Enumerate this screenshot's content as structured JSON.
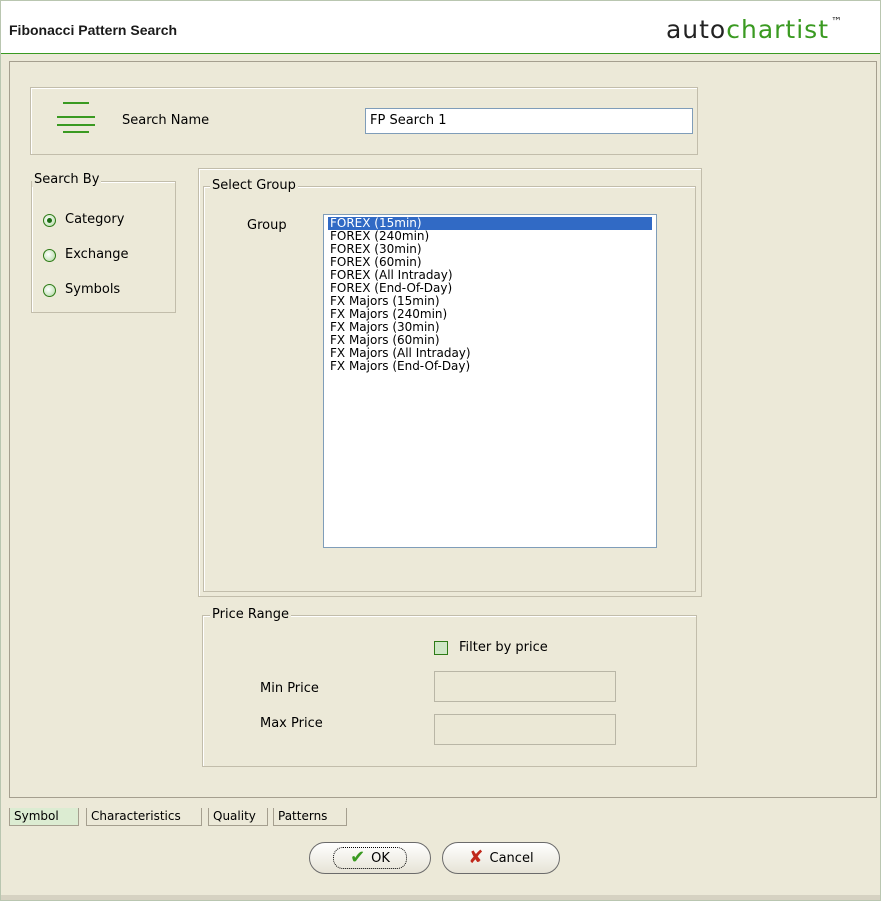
{
  "window": {
    "title": "Fibonacci Pattern Search",
    "logo_prefix": "auto",
    "logo_suffix": "chartist",
    "logo_tm": "™",
    "accent_color": "#3a9a21"
  },
  "search_name": {
    "label": "Search Name",
    "value": "FP Search 1",
    "icon": "lines-icon"
  },
  "search_by": {
    "caption": "Search By",
    "options": [
      {
        "label": "Category",
        "checked": true
      },
      {
        "label": "Exchange",
        "checked": false
      },
      {
        "label": "Symbols",
        "checked": false
      }
    ]
  },
  "select_group": {
    "caption": "Select Group",
    "label": "Group",
    "items": [
      "FOREX (15min)",
      "FOREX (240min)",
      "FOREX (30min)",
      "FOREX (60min)",
      "FOREX (All Intraday)",
      "FOREX (End-Of-Day)",
      "FX Majors (15min)",
      "FX Majors (240min)",
      "FX Majors (30min)",
      "FX Majors (60min)",
      "FX Majors (All Intraday)",
      "FX Majors (End-Of-Day)"
    ],
    "selected": "FOREX (15min)"
  },
  "price_range": {
    "caption": "Price Range",
    "filter_label": "Filter by price",
    "filter_checked": false,
    "min_label": "Min Price",
    "max_label": "Max Price",
    "min_value": "",
    "max_value": ""
  },
  "tabs": [
    {
      "label": "Symbol",
      "active": true
    },
    {
      "label": "Characteristics",
      "active": false
    },
    {
      "label": "Quality",
      "active": false
    },
    {
      "label": "Patterns",
      "active": false
    }
  ],
  "buttons": {
    "ok_label": "OK",
    "ok_icon": "checkmark-icon",
    "cancel_label": "Cancel",
    "cancel_icon": "x-icon"
  }
}
